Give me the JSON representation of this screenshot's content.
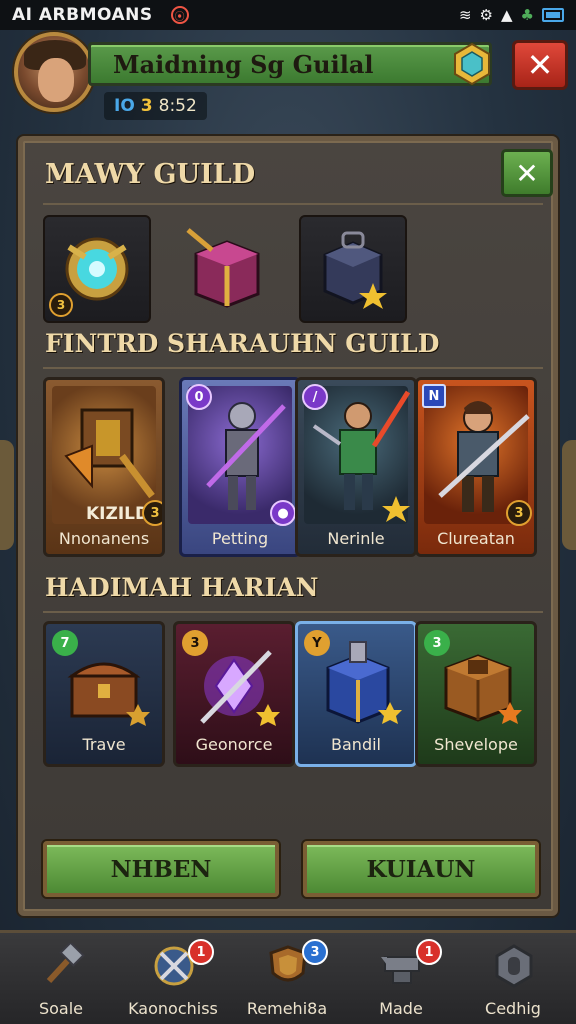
{
  "status_bar": {
    "carrier": "AI ARBMOANS",
    "rec_glyph": "⦿",
    "icons": [
      "wifi-icon",
      "settings-icon",
      "signal-icon",
      "tree-icon",
      "battery-icon"
    ]
  },
  "header": {
    "title": "Maidning Sg Guilal",
    "close_glyph": "✕",
    "stats_icon": "IO",
    "stats_bolt": "3",
    "stats_value": "8:52"
  },
  "panel": {
    "title": "MAWY GUILD",
    "close_glyph": "✕",
    "items": [
      {
        "badge": "3"
      },
      {
        "badge": ""
      },
      {
        "badge": ""
      }
    ],
    "guild_section_title": "FINTRD SHARAUHN GUILD",
    "heroes": [
      {
        "name": "Nnonanens",
        "tag": "KIZILD",
        "badge": "3"
      },
      {
        "name": "Petting",
        "tag": "",
        "badge": "0"
      },
      {
        "name": "Nerinle",
        "tag": "",
        "badge": "★"
      },
      {
        "name": "Clureatan",
        "tag": "",
        "badge": "3"
      }
    ],
    "rewards_section_title": "HADIMAH HARIAN",
    "rewards": [
      {
        "name": "Trave",
        "badge": "7"
      },
      {
        "name": "Geonorce",
        "badge": "3"
      },
      {
        "name": "Bandil",
        "badge": "Y"
      },
      {
        "name": "Shevelope",
        "badge": "3"
      }
    ],
    "buttons": {
      "left": "NHBEN",
      "right": "KUIAUN"
    }
  },
  "bottom_nav": [
    {
      "label": "Soale",
      "notif": ""
    },
    {
      "label": "Kaonochiss",
      "notif": "1"
    },
    {
      "label": "Remehi8a",
      "notif": "3"
    },
    {
      "label": "Made",
      "notif": "1"
    },
    {
      "label": "Cedhig",
      "notif": ""
    }
  ],
  "colors": {
    "accent_green": "#4d8a34",
    "close_red": "#c83424",
    "panel_bg": "#433f3a",
    "gold_text": "#efd9a8"
  }
}
